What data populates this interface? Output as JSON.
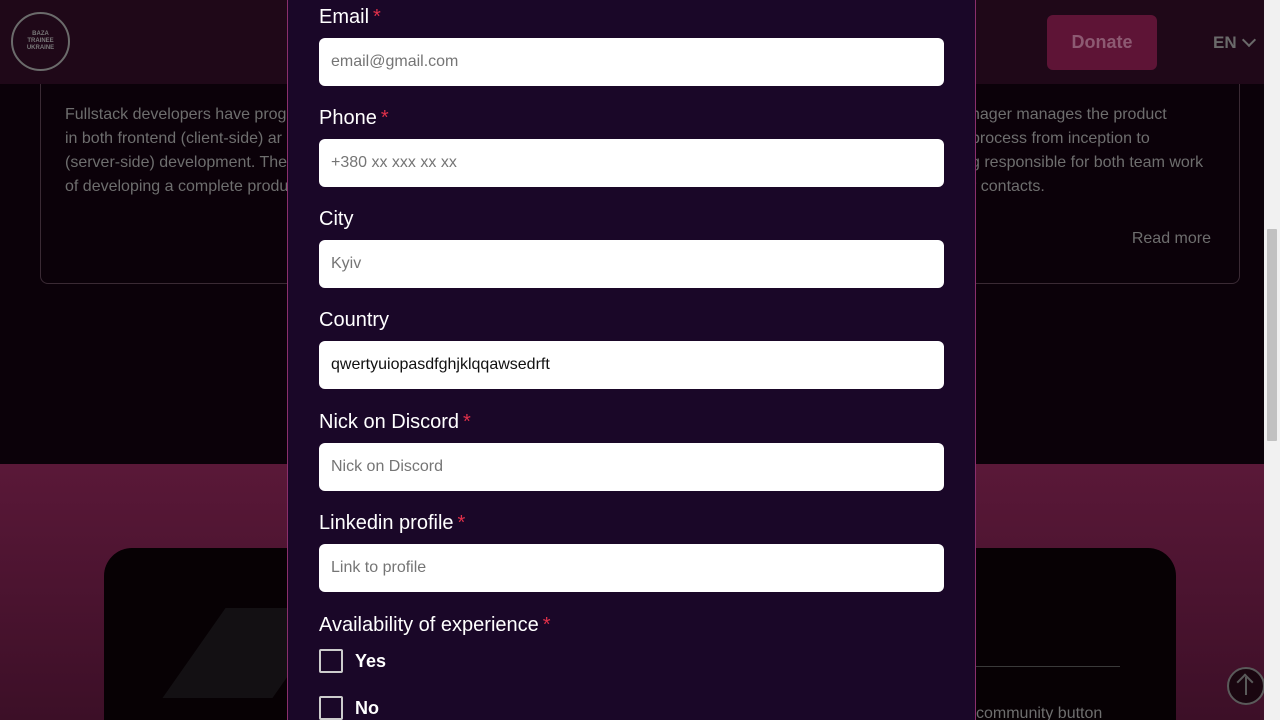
{
  "background": {
    "logo_lines": [
      "BAZA",
      "TRAINEE",
      "UKRAINE"
    ],
    "donate_label": "Donate",
    "language": "EN",
    "card_left_lines": [
      "Fullstack developers have prog",
      "in both frontend (client-side) ar",
      "(server-side) development. The",
      "of developing a complete produ"
    ],
    "card_right_lines": [
      "nager manages the product",
      "process from inception to",
      "g responsible for both team work",
      "r contacts."
    ],
    "read_more": "Read more",
    "panel_button_text": "community button"
  },
  "form": {
    "email": {
      "label": "Email",
      "required": "*",
      "placeholder": "email@gmail.com",
      "value": ""
    },
    "phone": {
      "label": "Phone",
      "required": "*",
      "placeholder": "+380 xx xxx xx xx",
      "value": ""
    },
    "city": {
      "label": "City",
      "placeholder": "Kyiv",
      "value": ""
    },
    "country": {
      "label": "Country",
      "placeholder": "",
      "value": "qwertyuiopasdfghjklqqawsedrft"
    },
    "discord": {
      "label": "Nick on Discord",
      "required": "*",
      "placeholder": "Nick on Discord",
      "value": ""
    },
    "linkedin": {
      "label": "Linkedin profile",
      "required": "*",
      "placeholder": "Link to profile",
      "value": ""
    },
    "experience": {
      "label": "Availability of experience",
      "required": "*",
      "options": [
        "Yes",
        "No"
      ]
    }
  }
}
